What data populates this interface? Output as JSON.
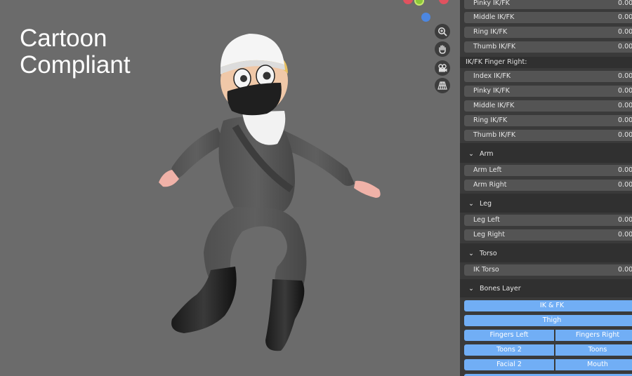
{
  "viewport": {
    "overlay_title": "Cartoon\nCompliant",
    "nav_icons": [
      "zoom-icon",
      "hand-pan-icon",
      "camera-icon",
      "grid-perspective-icon"
    ]
  },
  "panel": {
    "finger_left_rows": [
      {
        "label": "Pinky IK/FK",
        "value": "0.00"
      },
      {
        "label": "Middle IK/FK",
        "value": "0.00"
      },
      {
        "label": "Ring IK/FK",
        "value": "0.00"
      },
      {
        "label": "Thumb IK/FK",
        "value": "0.00"
      }
    ],
    "finger_right_title": "IK/FK Finger Right:",
    "finger_right_rows": [
      {
        "label": "Index IK/FK",
        "value": "0.00"
      },
      {
        "label": "Pinky IK/FK",
        "value": "0.00"
      },
      {
        "label": "Middle IK/FK",
        "value": "0.00"
      },
      {
        "label": "Ring IK/FK",
        "value": "0.00"
      },
      {
        "label": "Thumb IK/FK",
        "value": "0.00"
      }
    ],
    "arm": {
      "title": "Arm",
      "rows": [
        {
          "label": "Arm Left",
          "value": "0.00"
        },
        {
          "label": "Arm Right",
          "value": "0.00"
        }
      ]
    },
    "leg": {
      "title": "Leg",
      "rows": [
        {
          "label": "Leg Left",
          "value": "0.00"
        },
        {
          "label": "Leg Right",
          "value": "0.00"
        }
      ]
    },
    "torso": {
      "title": "Torso",
      "rows": [
        {
          "label": "IK Torso",
          "value": "0.00"
        }
      ]
    },
    "bones": {
      "title": "Bones Layer",
      "ik_fk": "IK & FK",
      "thigh": "Thigh",
      "fingers_left": "Fingers Left",
      "fingers_right": "Fingers Right",
      "toons2": "Toons 2",
      "toons": "Toons",
      "facial2": "Facial 2",
      "mouth": "Mouth"
    },
    "chevron": "⌄"
  },
  "colors": {
    "accent_blue": "#71aef5",
    "panel_bg": "#303030",
    "field_bg": "#545454"
  }
}
